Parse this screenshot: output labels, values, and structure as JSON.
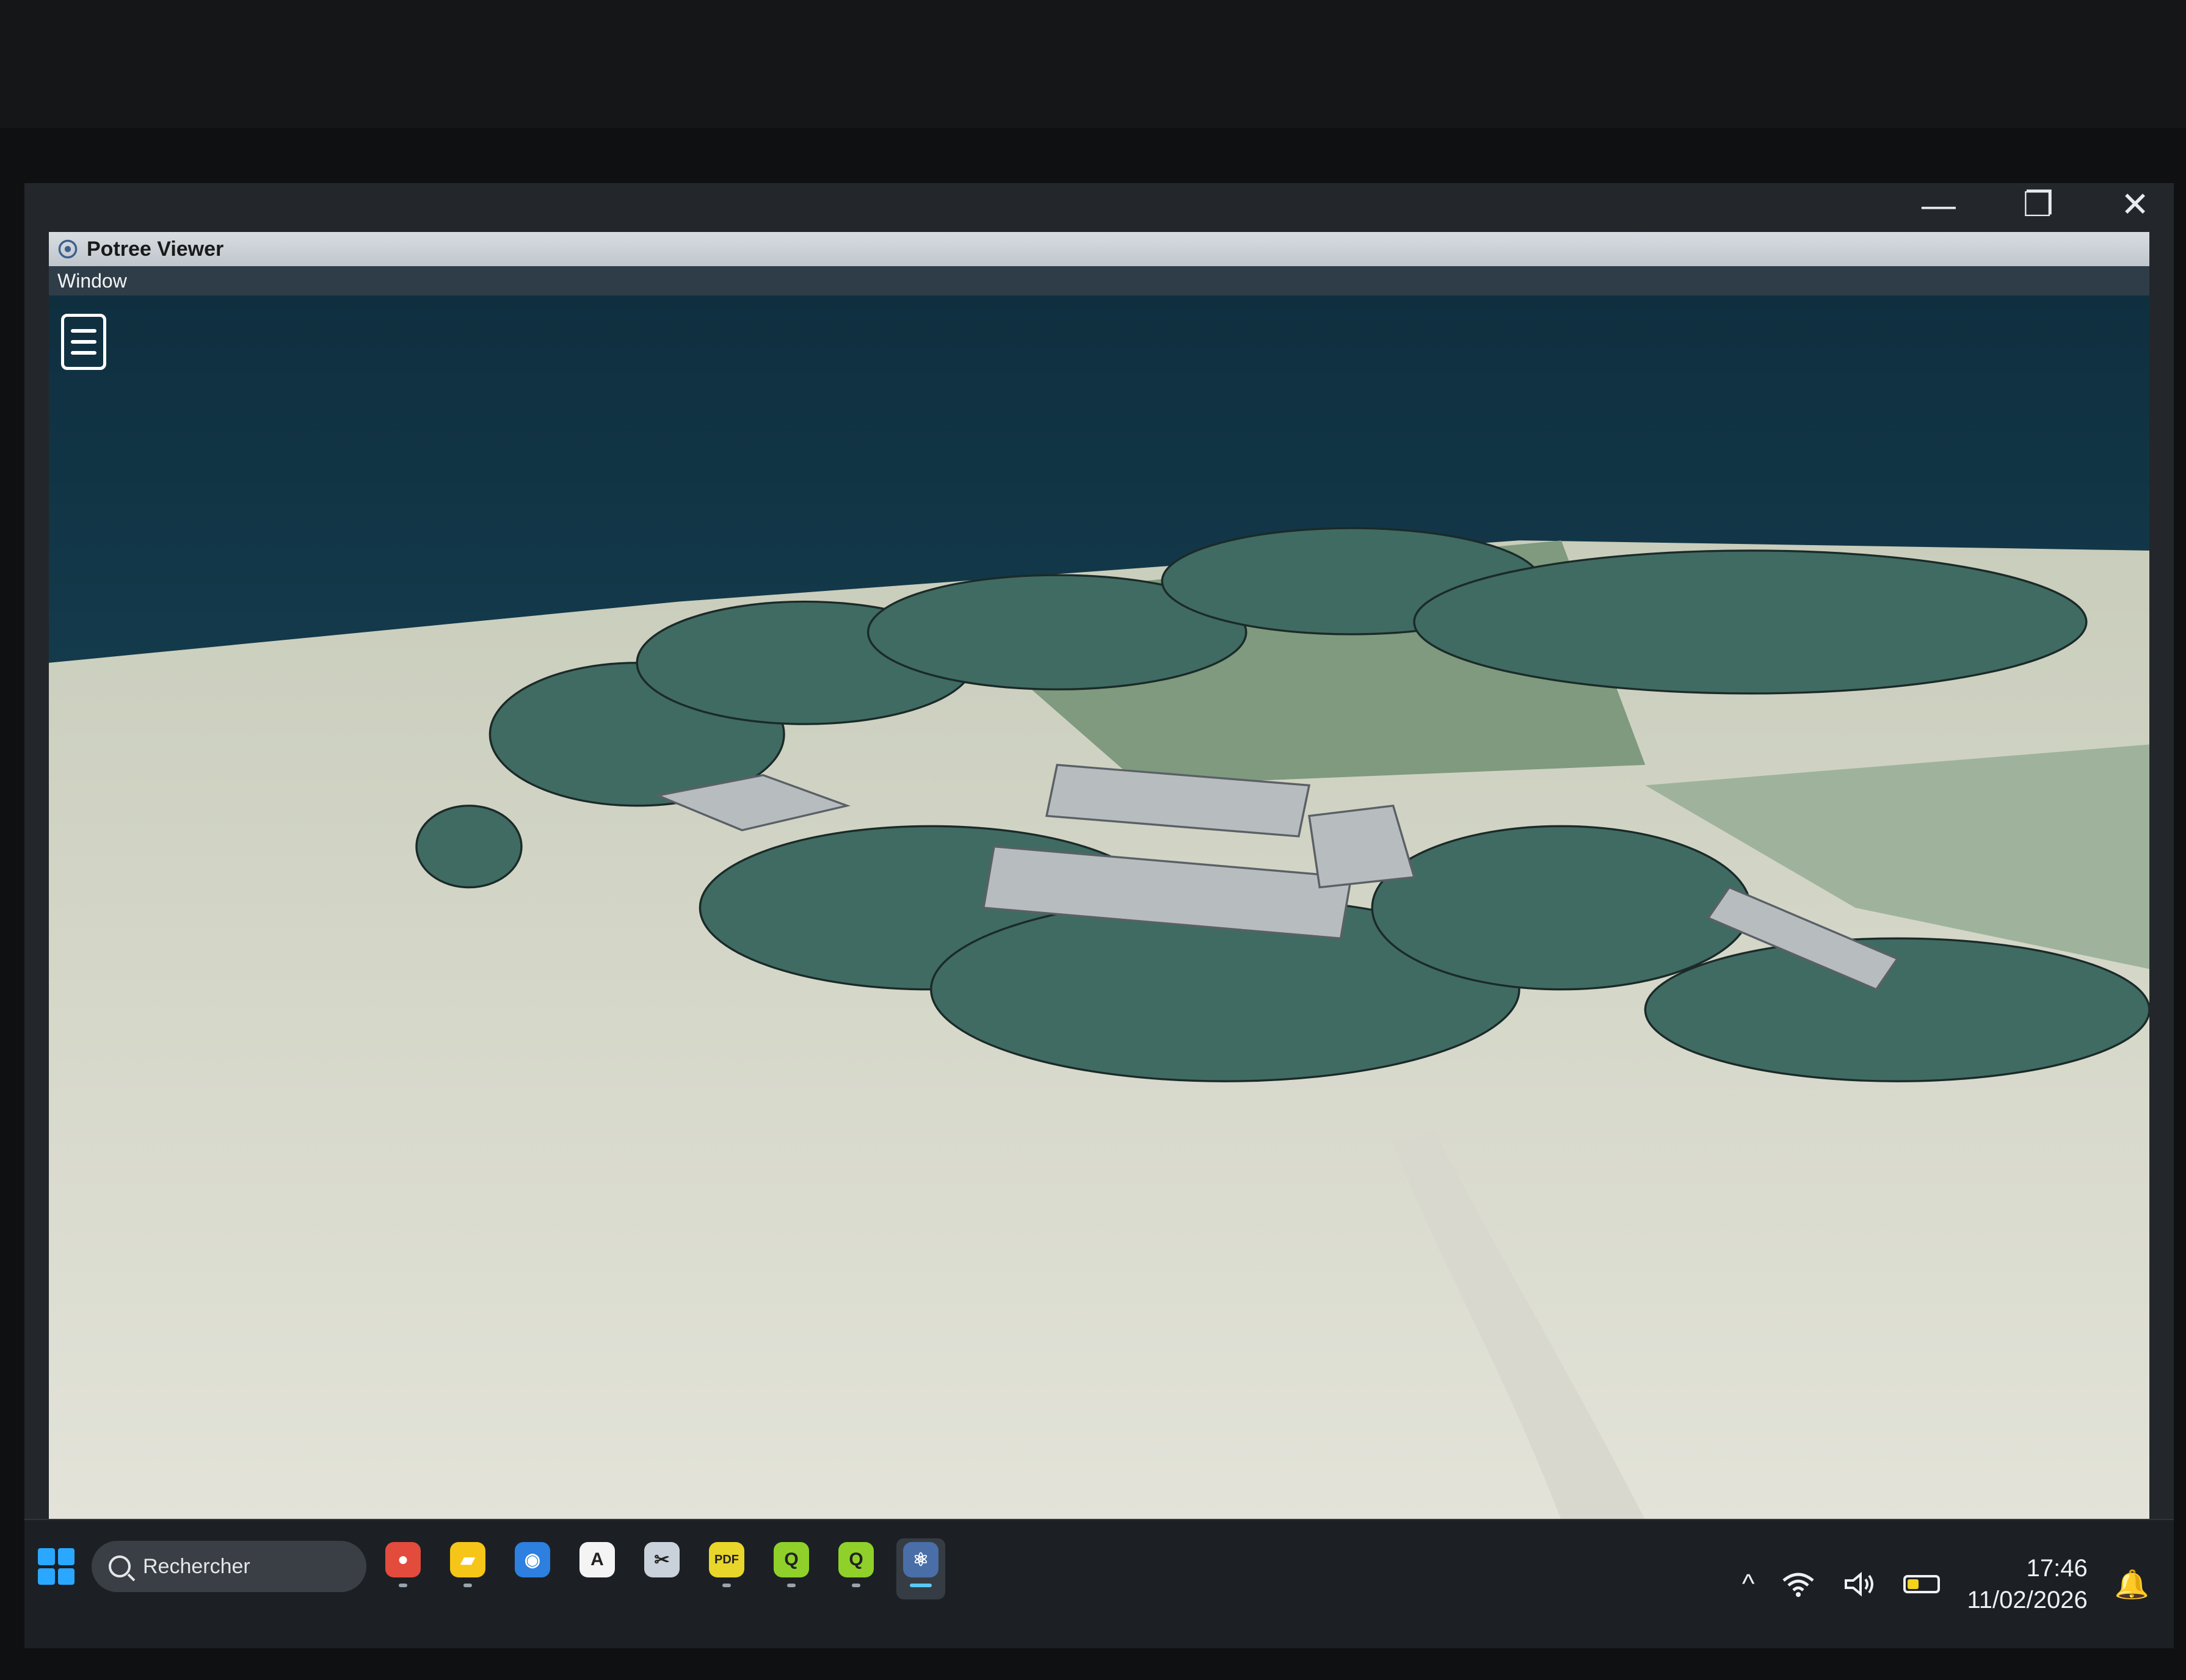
{
  "window": {
    "title": "Potree Viewer",
    "menu": [
      "Window"
    ],
    "controls": {
      "minimize": "—",
      "restore": "❐",
      "close": "✕"
    }
  },
  "viewer": {
    "menu_icon": "hamburger-menu-icon",
    "scene": "point-cloud-aerial-view"
  },
  "taskbar": {
    "search_placeholder": "Rechercher",
    "apps": [
      {
        "name": "chrome-dev",
        "icon": "chrome-icon",
        "color": "#e34b3c",
        "glyph": "●",
        "running": true
      },
      {
        "name": "file-explorer",
        "icon": "folder-icon",
        "color": "#f5c518",
        "glyph": "▰",
        "running": true
      },
      {
        "name": "firefox",
        "icon": "firefox-icon",
        "color": "#2d7fe0",
        "glyph": "◉",
        "running": false
      },
      {
        "name": "app-a",
        "icon": "a-icon",
        "color": "#f4f4f4",
        "glyph": "A",
        "running": false
      },
      {
        "name": "snipping-tool",
        "icon": "snip-icon",
        "color": "#c9d2da",
        "glyph": "✂",
        "running": false
      },
      {
        "name": "pdf-tool",
        "icon": "pdf-icon",
        "color": "#e8d62a",
        "glyph": "PDF",
        "running": true
      },
      {
        "name": "qgis-1",
        "icon": "qgis-icon",
        "color": "#8fd12a",
        "glyph": "Q",
        "running": true
      },
      {
        "name": "qgis-2",
        "icon": "qgis-icon",
        "color": "#8fd12a",
        "glyph": "Q",
        "running": true
      },
      {
        "name": "potree",
        "icon": "potree-icon",
        "color": "#4a6ea8",
        "glyph": "⚛",
        "running": true,
        "active": true
      }
    ],
    "tray": {
      "overflow_icon": "^",
      "wifi_icon": "wifi-icon",
      "volume_icon": "volume-icon",
      "battery_level": 0.4,
      "time": "17:46",
      "date": "11/02/2026",
      "notification_icon": "notification-icon"
    }
  }
}
